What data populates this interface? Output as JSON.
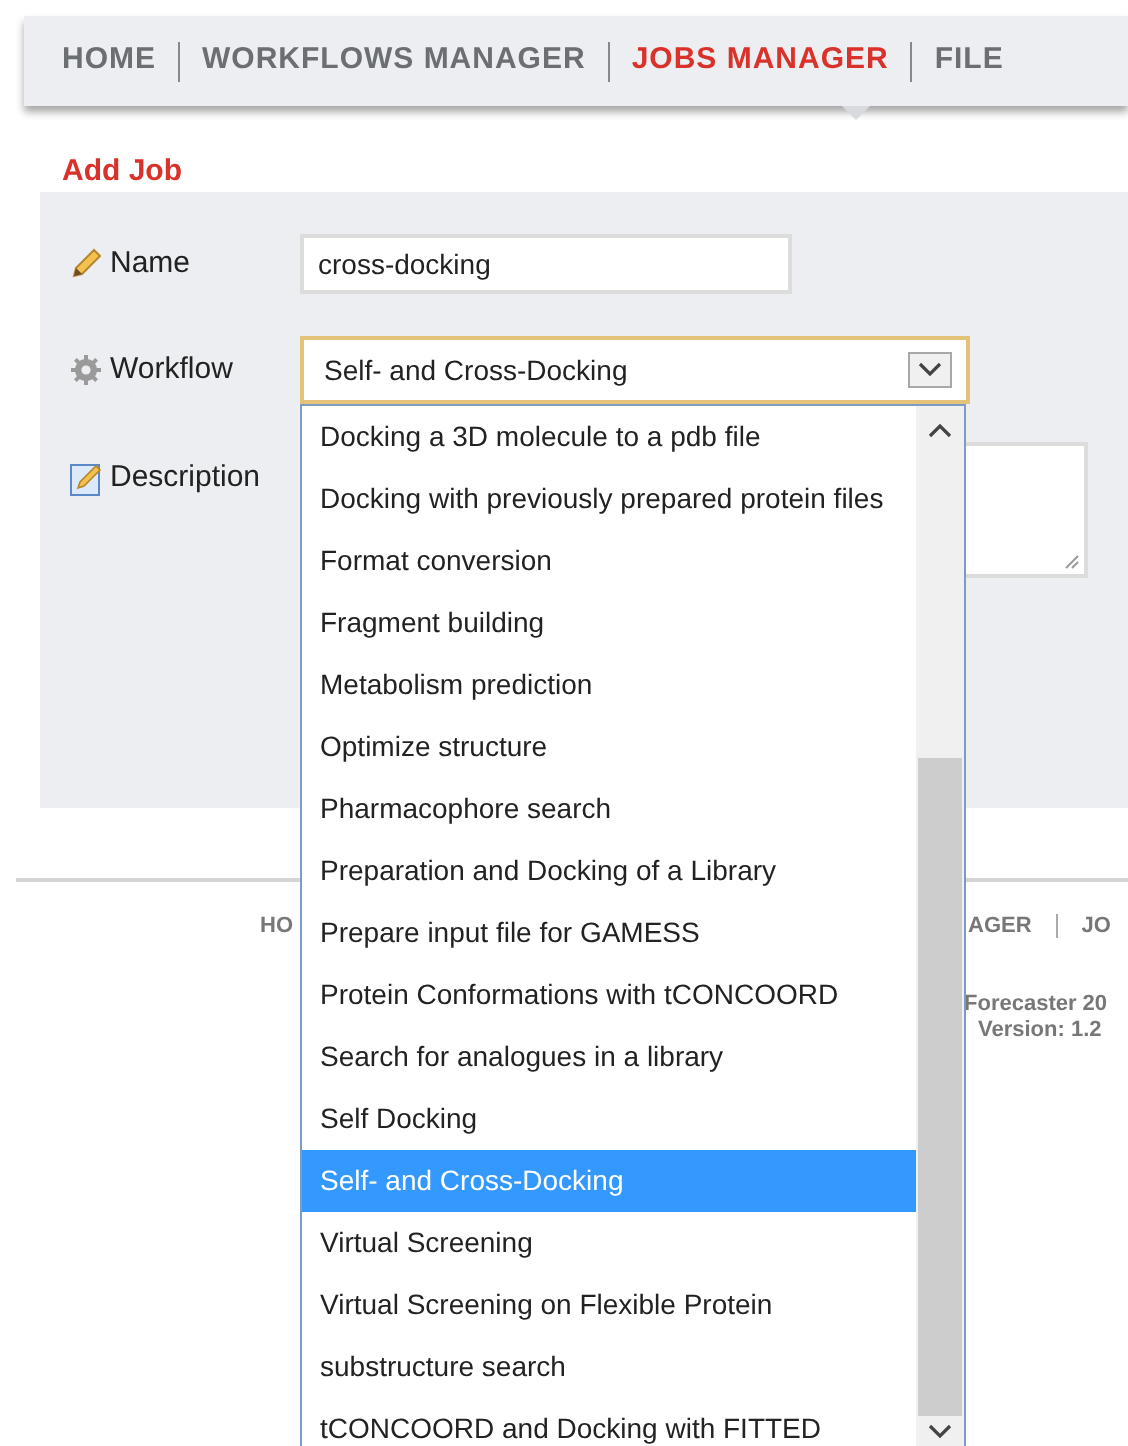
{
  "nav": [
    {
      "label": "HOME",
      "selected": false
    },
    {
      "label": "WORKFLOWS MANAGER",
      "selected": false
    },
    {
      "label": "JOBS MANAGER",
      "selected": true
    },
    {
      "label": "FILE",
      "selected": false
    }
  ],
  "heading": "Add Job",
  "form": {
    "name": {
      "label": "Name",
      "value": "cross-docking"
    },
    "workflow": {
      "label": "Workflow",
      "value": "Self- and Cross-Docking"
    },
    "description": {
      "label": "Description"
    }
  },
  "dropdown": [
    {
      "label": "Docking a 3D molecule to a pdb file",
      "selected": false
    },
    {
      "label": "Docking with previously prepared protein files",
      "selected": false
    },
    {
      "label": "Format conversion",
      "selected": false
    },
    {
      "label": "Fragment building",
      "selected": false
    },
    {
      "label": "Metabolism prediction",
      "selected": false
    },
    {
      "label": "Optimize structure",
      "selected": false
    },
    {
      "label": "Pharmacophore search",
      "selected": false
    },
    {
      "label": "Preparation and Docking of a Library",
      "selected": false
    },
    {
      "label": "Prepare input file for GAMESS",
      "selected": false
    },
    {
      "label": "Protein Conformations with tCONCOORD",
      "selected": false
    },
    {
      "label": "Search for analogues in a library",
      "selected": false
    },
    {
      "label": "Self Docking",
      "selected": false
    },
    {
      "label": "Self- and Cross-Docking",
      "selected": true
    },
    {
      "label": "Virtual Screening",
      "selected": false
    },
    {
      "label": "Virtual Screening on Flexible Protein",
      "selected": false
    },
    {
      "label": "substructure search",
      "selected": false
    },
    {
      "label": "tCONCOORD and Docking with FITTED",
      "selected": false
    }
  ],
  "footer": {
    "nav_left": "HO",
    "nav_right": [
      "AGER",
      "JO"
    ],
    "credit": "Forecaster 20",
    "version": "Version: 1.2"
  }
}
